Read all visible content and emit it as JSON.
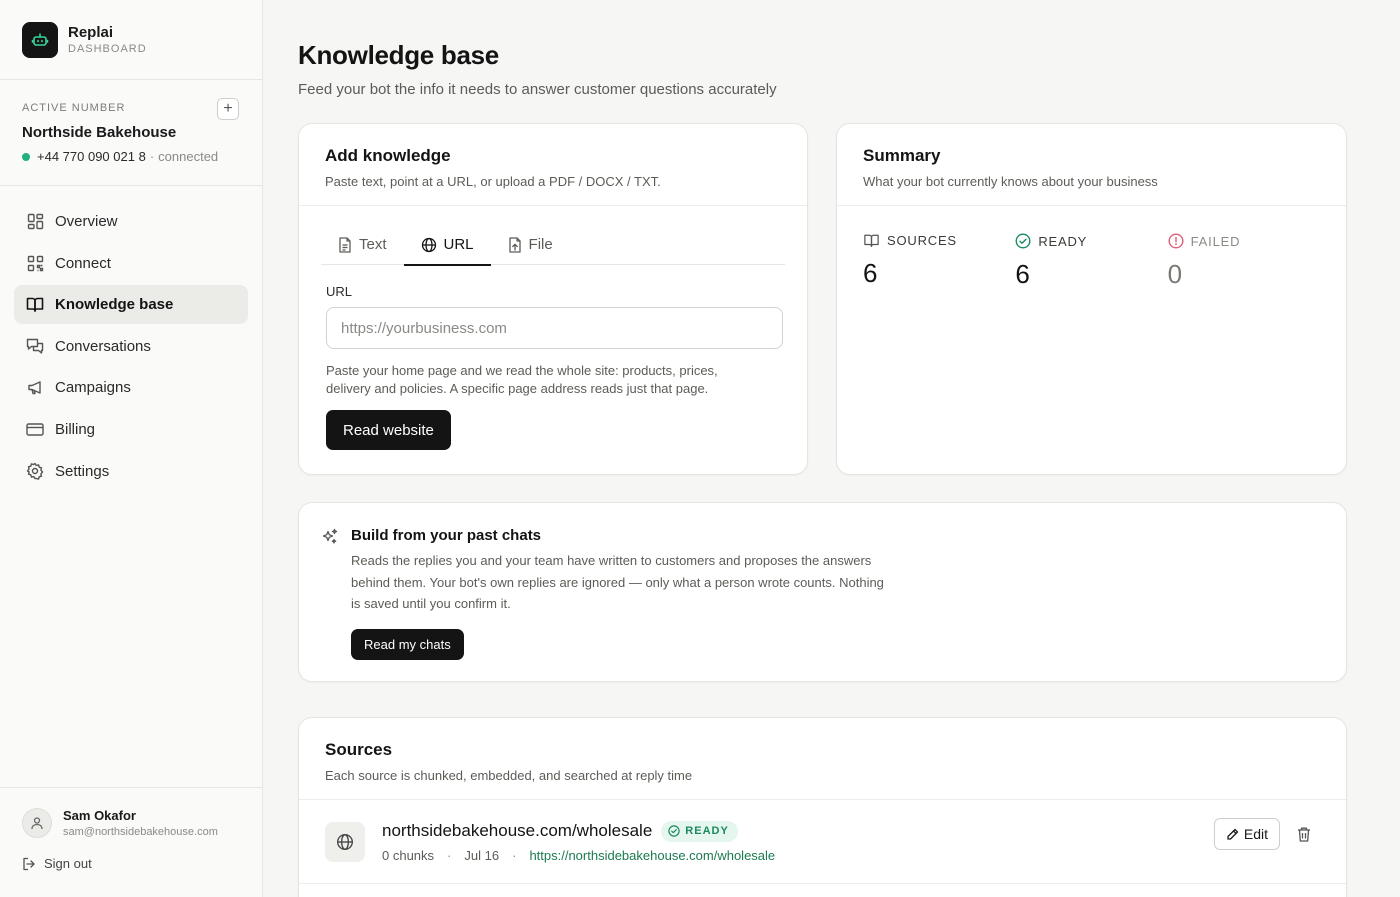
{
  "brand": {
    "name": "Replai",
    "sub": "DASHBOARD",
    "logo_icon": "bot-icon"
  },
  "active_number": {
    "label": "ACTIVE NUMBER",
    "business": "Northside Bakehouse",
    "phone": "+44 770 090 021 8",
    "separator": "·",
    "status": "connected",
    "status_color": "#22b07d",
    "add_label": "+"
  },
  "nav": {
    "items": [
      {
        "label": "Overview",
        "icon": "grid-icon"
      },
      {
        "label": "Connect",
        "icon": "qr-icon"
      },
      {
        "label": "Knowledge base",
        "icon": "book-icon",
        "active": true
      },
      {
        "label": "Conversations",
        "icon": "chat-icon"
      },
      {
        "label": "Campaigns",
        "icon": "megaphone-icon"
      },
      {
        "label": "Billing",
        "icon": "card-icon"
      },
      {
        "label": "Settings",
        "icon": "gear-icon"
      }
    ]
  },
  "user": {
    "name": "Sam Okafor",
    "email": "sam@northsidebakehouse.com",
    "signout": "Sign out"
  },
  "page": {
    "title": "Knowledge base",
    "subtitle": "Feed your bot the info it needs to answer customer questions accurately"
  },
  "add_knowledge": {
    "title": "Add knowledge",
    "subtitle": "Paste text, point at a URL, or upload a PDF / DOCX / TXT.",
    "tabs": [
      {
        "label": "Text",
        "icon": "document-icon"
      },
      {
        "label": "URL",
        "icon": "globe-icon",
        "active": true
      },
      {
        "label": "File",
        "icon": "file-upload-icon"
      }
    ],
    "field_label": "URL",
    "placeholder": "https://yourbusiness.com",
    "value": "",
    "hint": "Paste your home page and we read the whole site: products, prices, delivery and policies. A specific page address reads just that page.",
    "button": "Read website"
  },
  "summary": {
    "title": "Summary",
    "subtitle": "What your bot currently knows about your business",
    "stats": [
      {
        "label": "SOURCES",
        "value": "6",
        "icon": "book-icon"
      },
      {
        "label": "READY",
        "value": "6",
        "icon": "check-circle-icon",
        "color": "#1b8a5e"
      },
      {
        "label": "FAILED",
        "value": "0",
        "icon": "alert-circle-icon",
        "color": "#d9607a"
      }
    ]
  },
  "chats": {
    "title": "Build from your past chats",
    "description": "Reads the replies you and your team have written to customers and proposes the answers behind them. Your bot's own replies are ignored — only what a person wrote counts. Nothing is saved until you confirm it.",
    "button": "Read my chats"
  },
  "sources": {
    "title": "Sources",
    "subtitle": "Each source is chunked, embedded, and searched at reply time",
    "items": [
      {
        "title": "northsidebakehouse.com/wholesale",
        "badge": "READY",
        "chunks": "0 chunks",
        "date": "Jul 16",
        "url": "https://northsidebakehouse.com/wholesale",
        "sep": "·",
        "edit_label": "Edit"
      }
    ]
  }
}
